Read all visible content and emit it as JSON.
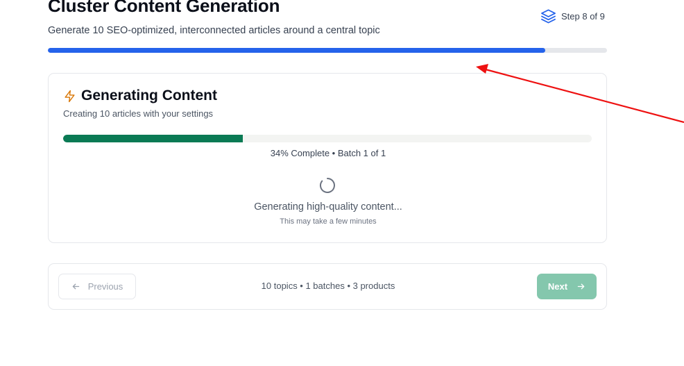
{
  "header": {
    "title": "Cluster Content Generation",
    "subtitle": "Generate 10 SEO-optimized, interconnected articles around a central topic",
    "step_label": "Step 8 of 9",
    "step_icon": "layers-icon",
    "overall_progress": 0.89,
    "accent_color": "#2563eb"
  },
  "card": {
    "title": "Generating Content",
    "title_icon": "bolt-icon",
    "description": "Creating 10 articles with your settings",
    "progress": 0.34,
    "progress_text": "34% Complete • Batch 1 of 1",
    "progress_color": "#0a7a54",
    "status_main": "Generating high-quality content...",
    "status_sub": "This may take a few minutes"
  },
  "footer": {
    "previous_label": "Previous",
    "summary": "10 topics • 1 batches  • 3 products",
    "next_label": "Next",
    "next_color": "#84c7ad"
  },
  "annotation": {
    "arrow_color": "#ee1111"
  }
}
